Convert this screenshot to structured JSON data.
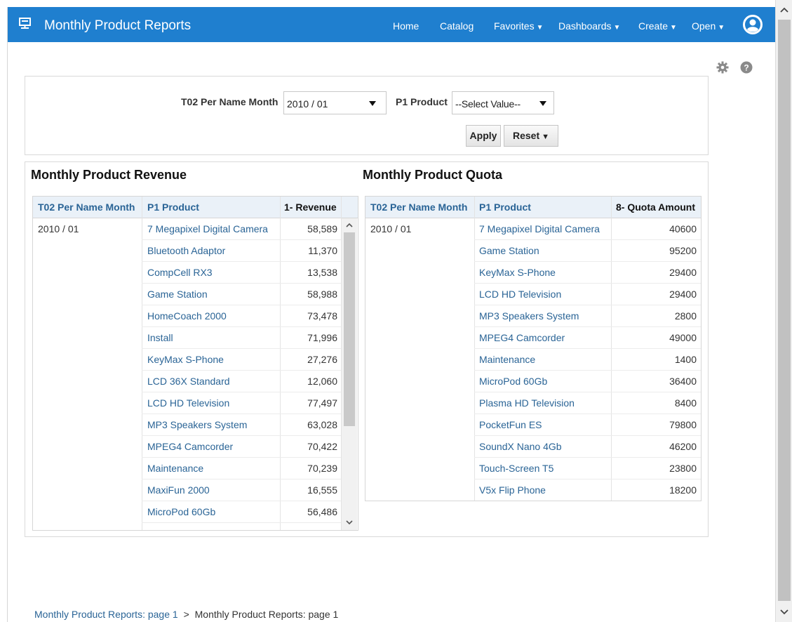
{
  "header": {
    "title": "Monthly Product Reports",
    "nav": [
      {
        "label": "Home",
        "has_menu": false
      },
      {
        "label": "Catalog",
        "has_menu": false
      },
      {
        "label": "Favorites",
        "has_menu": true
      },
      {
        "label": "Dashboards",
        "has_menu": true
      },
      {
        "label": "Create",
        "has_menu": true
      },
      {
        "label": "Open",
        "has_menu": true
      }
    ],
    "caret": "▼",
    "accent_color": "#1f7fcf"
  },
  "prompts": {
    "month_label": "T02 Per Name Month",
    "month_value": "2010 / 01",
    "product_label": "P1 Product",
    "product_value": "--Select Value--",
    "apply_label": "Apply",
    "reset_label": "Reset"
  },
  "revenue": {
    "title": "Monthly Product Revenue",
    "columns": [
      "T02 Per Name Month",
      "P1 Product",
      "1- Revenue"
    ],
    "month": "2010 / 01",
    "rows": [
      {
        "product": "7 Megapixel Digital Camera",
        "value": "58,589"
      },
      {
        "product": "Bluetooth Adaptor",
        "value": "11,370"
      },
      {
        "product": "CompCell RX3",
        "value": "13,538"
      },
      {
        "product": "Game Station",
        "value": "58,988"
      },
      {
        "product": "HomeCoach 2000",
        "value": "73,478"
      },
      {
        "product": "Install",
        "value": "71,996"
      },
      {
        "product": "KeyMax S-Phone",
        "value": "27,276"
      },
      {
        "product": "LCD 36X Standard",
        "value": "12,060"
      },
      {
        "product": "LCD HD Television",
        "value": "77,497"
      },
      {
        "product": "MP3 Speakers System",
        "value": "63,028"
      },
      {
        "product": "MPEG4 Camcorder",
        "value": "70,422"
      },
      {
        "product": "Maintenance",
        "value": "70,239"
      },
      {
        "product": "MaxiFun 2000",
        "value": "16,555"
      },
      {
        "product": "MicroPod 60Gb",
        "value": "56,486"
      }
    ]
  },
  "quota": {
    "title": "Monthly Product Quota",
    "columns": [
      "T02 Per Name Month",
      "P1 Product",
      "8- Quota Amount"
    ],
    "month": "2010 / 01",
    "rows": [
      {
        "product": "7 Megapixel Digital Camera",
        "value": "40600"
      },
      {
        "product": "Game Station",
        "value": "95200"
      },
      {
        "product": "KeyMax S-Phone",
        "value": "29400"
      },
      {
        "product": "LCD HD Television",
        "value": "29400"
      },
      {
        "product": "MP3 Speakers System",
        "value": "2800"
      },
      {
        "product": "MPEG4 Camcorder",
        "value": "49000"
      },
      {
        "product": "Maintenance",
        "value": "1400"
      },
      {
        "product": "MicroPod 60Gb",
        "value": "36400"
      },
      {
        "product": "Plasma HD Television",
        "value": "8400"
      },
      {
        "product": "PocketFun ES",
        "value": "79800"
      },
      {
        "product": "SoundX Nano 4Gb",
        "value": "46200"
      },
      {
        "product": "Touch-Screen T5",
        "value": "23800"
      },
      {
        "product": "V5x Flip Phone",
        "value": "18200"
      }
    ]
  },
  "breadcrumb": {
    "first": "Monthly Product Reports: page 1",
    "separator": ">",
    "current": "Monthly Product Reports: page 1"
  },
  "icons": {
    "app": "presentation-icon",
    "user": "user-icon",
    "settings": "gear-icon",
    "help": "help-icon"
  }
}
